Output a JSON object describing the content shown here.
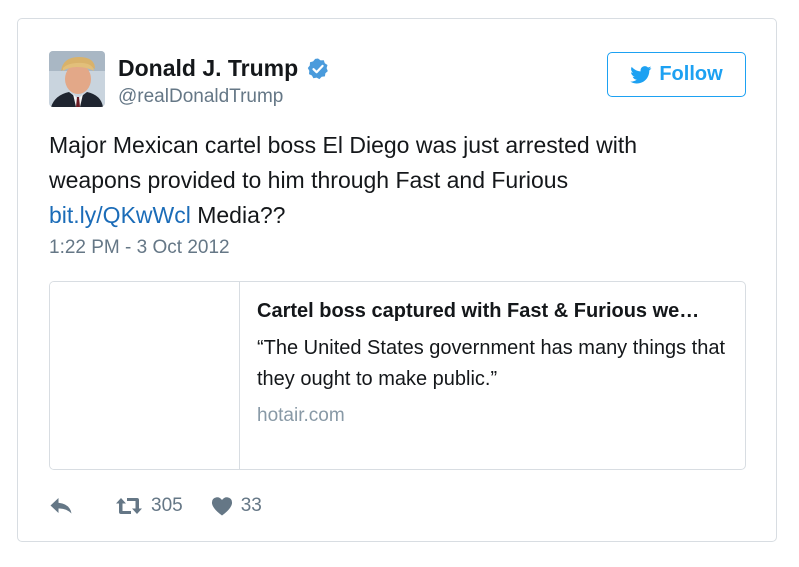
{
  "author": {
    "name": "Donald J. Trump",
    "handle": "@realDonaldTrump",
    "verified": true
  },
  "follow_button": {
    "label": "Follow",
    "icon": "twitter-bird-icon"
  },
  "tweet": {
    "text_before_link": "Major Mexican cartel boss El Diego was just arrested with weapons provided to him through Fast and Furious",
    "link_text": "bit.ly/QKwWcl",
    "text_after_link": "Media??",
    "timestamp": "1:22 PM - 3 Oct 2012"
  },
  "link_card": {
    "title": "Cartel boss captured with Fast & Furious we…",
    "description": "“The United States government has many things that they ought to make public.”",
    "domain": "hotair.com"
  },
  "actions": {
    "reply_icon": "reply-icon",
    "retweet_icon": "retweet-icon",
    "retweet_count": "305",
    "like_icon": "heart-icon",
    "like_count": "33"
  },
  "colors": {
    "accent": "#1da1f2",
    "link": "#1b6cb8",
    "text": "#14171a",
    "muted": "#657786",
    "border": "#d8dde2"
  }
}
